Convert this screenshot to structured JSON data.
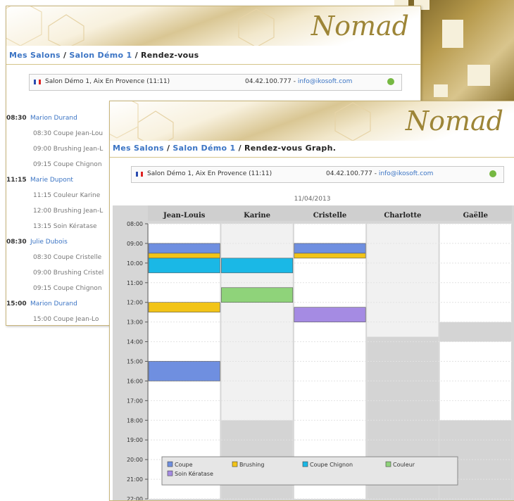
{
  "brand": "Nomad",
  "breadcrumb": {
    "link1": "Mes Salons",
    "sep1": " / ",
    "link2": "Salon Démo 1",
    "sep2": " / ",
    "current_list": "Rendez-vous",
    "current_graph": "Rendez-vous Graph."
  },
  "salon": {
    "name": "Salon Démo 1, Aix En Provence (11:11)",
    "phone": "04.42.100.777",
    "dash": " - ",
    "email": "info@ikosoft.com"
  },
  "date": "11/04/2013",
  "list": [
    {
      "time": "08:30",
      "client": "Marion Durand",
      "items": [
        "08:30 Coupe Jean-Lou",
        "09:00 Brushing Jean-L",
        "09:15 Coupe Chignon"
      ]
    },
    {
      "time": "11:15",
      "client": "Marie Dupont",
      "items": [
        "11:15 Couleur Karine",
        "12:00 Brushing Jean-L",
        "13:15 Soin Kératase"
      ]
    },
    {
      "time": "08:30",
      "client": "Julie Dubois",
      "items": [
        "08:30 Coupe Cristelle",
        "09:00 Brushing Cristel",
        "09:15 Coupe Chignon"
      ]
    },
    {
      "time": "15:00",
      "client": "Marion Durand",
      "items": [
        "15:00 Coupe Jean-Lo"
      ]
    }
  ],
  "colors": {
    "coupe": "#6f8fe0",
    "brushing": "#f2c418",
    "chignon": "#1ab8e6",
    "couleur": "#8fd37a",
    "kerastase": "#a58be3",
    "brand": "#9d8537",
    "link": "#3b74c4"
  },
  "chart_data": {
    "type": "table",
    "columns": [
      "Jean-Louis",
      "Karine",
      "Cristelle",
      "Charlotte",
      "Gaëlle"
    ],
    "time_ticks": [
      "08:00",
      "09:00",
      "10:00",
      "11:00",
      "12:00",
      "13:00",
      "14:00",
      "15:00",
      "16:00",
      "17:00",
      "18:00",
      "19:00",
      "20:00",
      "21:00",
      "22:00"
    ],
    "range": [
      8,
      22
    ],
    "appointments": [
      {
        "column": 0,
        "type": "Coupe",
        "start": 9.0,
        "end": 9.5
      },
      {
        "column": 0,
        "type": "Brushing",
        "start": 9.5,
        "end": 9.75
      },
      {
        "column": 0,
        "type": "Coupe Chignon",
        "start": 9.75,
        "end": 10.5
      },
      {
        "column": 0,
        "type": "Brushing",
        "start": 12.0,
        "end": 12.5
      },
      {
        "column": 0,
        "type": "Coupe",
        "start": 15.0,
        "end": 16.0
      },
      {
        "column": 1,
        "type": "Coupe Chignon",
        "start": 9.75,
        "end": 10.5
      },
      {
        "column": 1,
        "type": "Couleur",
        "start": 11.25,
        "end": 12.0
      },
      {
        "column": 2,
        "type": "Coupe",
        "start": 9.0,
        "end": 9.5
      },
      {
        "column": 2,
        "type": "Brushing",
        "start": 9.5,
        "end": 9.75
      },
      {
        "column": 2,
        "type": "Kérastase",
        "start": 12.25,
        "end": 13.0
      }
    ],
    "unavailable": [
      {
        "column": 1,
        "start": 18.0,
        "end": 22.0
      },
      {
        "column": 3,
        "start": 13.75,
        "end": 22.0
      },
      {
        "column": 4,
        "start": 13.0,
        "end": 14.0
      },
      {
        "column": 4,
        "start": 18.0,
        "end": 22.0
      }
    ],
    "legend": [
      {
        "label": "Coupe",
        "key": "coupe"
      },
      {
        "label": "Brushing",
        "key": "brushing"
      },
      {
        "label": "Coupe Chignon",
        "key": "chignon"
      },
      {
        "label": "Couleur",
        "key": "couleur"
      },
      {
        "label": "Soin Kératase",
        "key": "kerastase"
      }
    ],
    "grid": true
  }
}
